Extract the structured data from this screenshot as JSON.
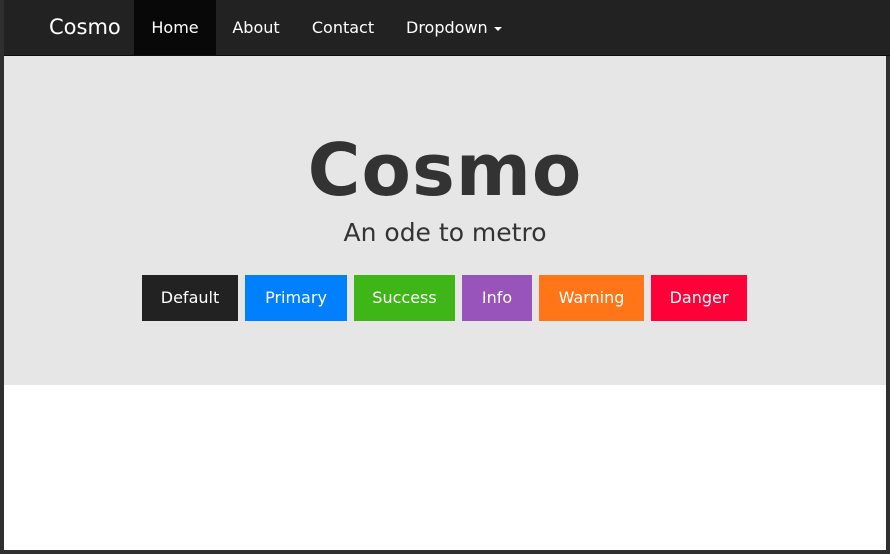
{
  "navbar": {
    "brand": "Cosmo",
    "items": [
      {
        "label": "Home",
        "active": true
      },
      {
        "label": "About",
        "active": false
      },
      {
        "label": "Contact",
        "active": false
      },
      {
        "label": "Dropdown",
        "active": false,
        "has_caret": true
      }
    ]
  },
  "jumbotron": {
    "title": "Cosmo",
    "subtitle": "An ode to metro",
    "buttons": [
      {
        "label": "Default",
        "color": "#222222"
      },
      {
        "label": "Primary",
        "color": "#007fff"
      },
      {
        "label": "Success",
        "color": "#3fb618"
      },
      {
        "label": "Info",
        "color": "#9954bb"
      },
      {
        "label": "Warning",
        "color": "#ff7518"
      },
      {
        "label": "Danger",
        "color": "#ff0039"
      }
    ]
  },
  "colors": {
    "navbar_bg": "#222222",
    "navbar_active_bg": "#080808",
    "jumbotron_bg": "#e6e6e6",
    "text_dark": "#333333"
  }
}
